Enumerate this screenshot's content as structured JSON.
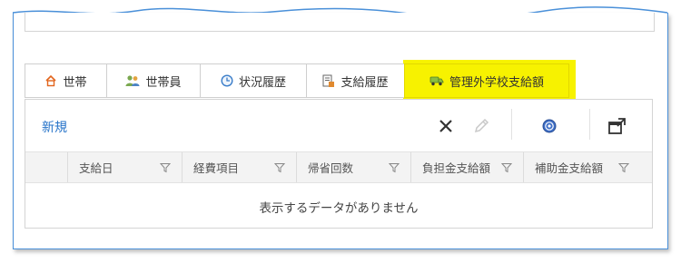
{
  "tabs": [
    {
      "label": "世帯",
      "icon": "house-icon"
    },
    {
      "label": "世帯員",
      "icon": "people-icon"
    },
    {
      "label": "状況履歴",
      "icon": "clock-icon"
    },
    {
      "label": "支給履歴",
      "icon": "document-stack-icon"
    },
    {
      "label": "管理外学校支給額",
      "icon": "truck-icon",
      "active": true
    }
  ],
  "toolbar": {
    "new_label": "新規",
    "delete_icon": "close-icon",
    "edit_icon": "pencil-icon",
    "help_icon": "help-icon",
    "popout_icon": "popout-window-icon"
  },
  "grid": {
    "columns": [
      "支給日",
      "経費項目",
      "帰省回数",
      "負担金支給額",
      "補助金支給額"
    ],
    "empty_message": "表示するデータがありません"
  },
  "colors": {
    "accent_link": "#2673c9",
    "highlight": "#f7f200",
    "frame_border": "#4a90d9"
  }
}
